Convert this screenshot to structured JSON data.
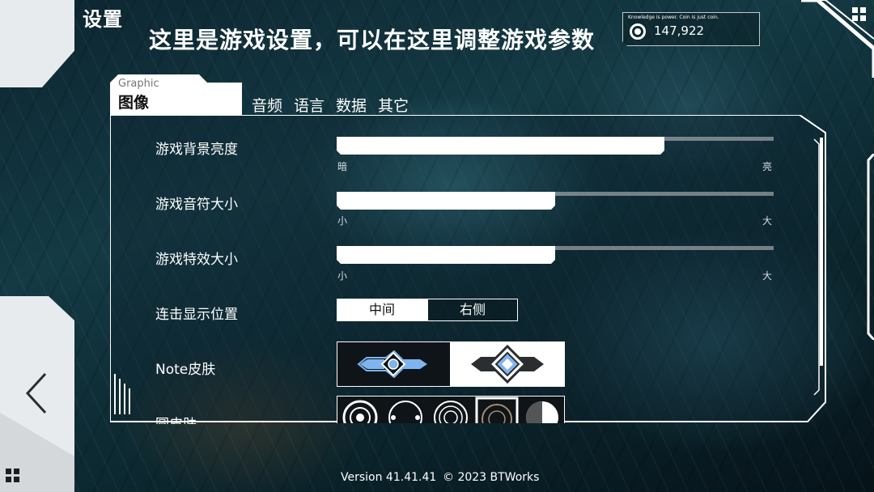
{
  "header": {
    "title": "设置",
    "subtitle": "这里是游戏设置，可以在这里调整游戏参数"
  },
  "coins": {
    "tagline": "Knowledge is power. Coin is just coin.",
    "value": "147,922"
  },
  "tabs": {
    "active": {
      "sub": "Graphic",
      "label": "图像"
    },
    "others": [
      "音频",
      "语言",
      "数据",
      "其它"
    ]
  },
  "settings": {
    "brightness": {
      "label": "游戏背景亮度",
      "min_label": "暗",
      "max_label": "亮",
      "value": 0.75
    },
    "note_size": {
      "label": "游戏音符大小",
      "min_label": "小",
      "max_label": "大",
      "value": 0.5
    },
    "effect_size": {
      "label": "游戏特效大小",
      "min_label": "小",
      "max_label": "大",
      "value": 0.5
    },
    "combo_position": {
      "label": "连击显示位置",
      "options": [
        "中间",
        "右侧"
      ],
      "selected": "中间"
    },
    "note_skin": {
      "label": "Note皮肤",
      "selected_index": 1
    },
    "circle_skin": {
      "label": "圆皮肤",
      "selected_index": 3
    }
  },
  "footer": {
    "version": "Version 41.41.41",
    "copyright": "© 2023 BTWorks"
  },
  "colors": {
    "accent_blue": "#7fb4ef",
    "panel_line": "#ffffff",
    "bg_dark": "#0c2530"
  }
}
